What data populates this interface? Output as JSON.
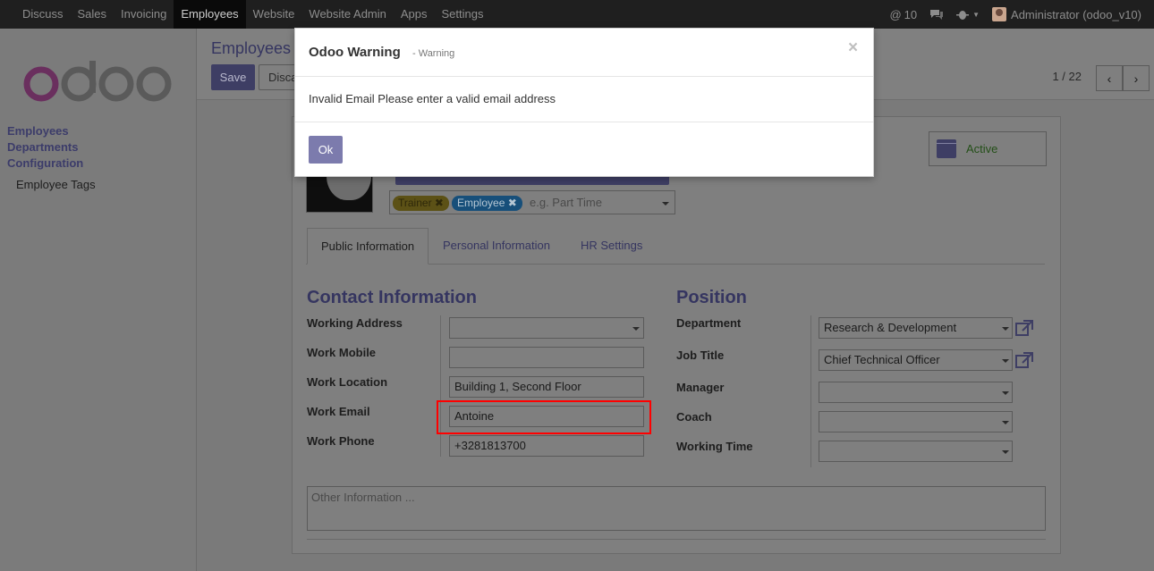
{
  "topbar": {
    "menu": [
      "Discuss",
      "Sales",
      "Invoicing",
      "Employees",
      "Website",
      "Website Admin",
      "Apps",
      "Settings"
    ],
    "active_menu": "Employees",
    "messages_count": "10",
    "user": "Administrator (odoo_v10)"
  },
  "sidebar": {
    "logo_text": "odoo",
    "links": [
      "Employees",
      "Departments",
      "Configuration"
    ],
    "sub_links": [
      "Employee Tags"
    ]
  },
  "control_panel": {
    "breadcrumb": "Employees",
    "save_label": "Save",
    "discard_label": "Discard",
    "pager": "1 / 22"
  },
  "form": {
    "tags": [
      "Trainer",
      "Employee"
    ],
    "tags_placeholder": "e.g. Part Time",
    "active_label": "Active",
    "tabs": [
      "Public Information",
      "Personal Information",
      "HR Settings"
    ],
    "contact": {
      "title": "Contact Information",
      "labels": [
        "Working Address",
        "Work Mobile",
        "Work Location",
        "Work Email",
        "Work Phone"
      ],
      "values": {
        "working_address": "",
        "work_mobile": "",
        "work_location": "Building 1, Second Floor",
        "work_email": "Antoine",
        "work_phone": "+3281813700"
      }
    },
    "position": {
      "title": "Position",
      "labels": [
        "Department",
        "Job Title",
        "Manager",
        "Coach",
        "Working Time"
      ],
      "values": {
        "department": "Research & Development",
        "job_title": "Chief Technical Officer",
        "manager": "",
        "coach": "",
        "working_time": ""
      }
    },
    "other_info_placeholder": "Other Information ..."
  },
  "modal": {
    "title": "Odoo Warning",
    "subtitle": "- Warning",
    "message": "Invalid Email Please enter a valid email address",
    "ok_label": "Ok",
    "close_symbol": "×"
  }
}
